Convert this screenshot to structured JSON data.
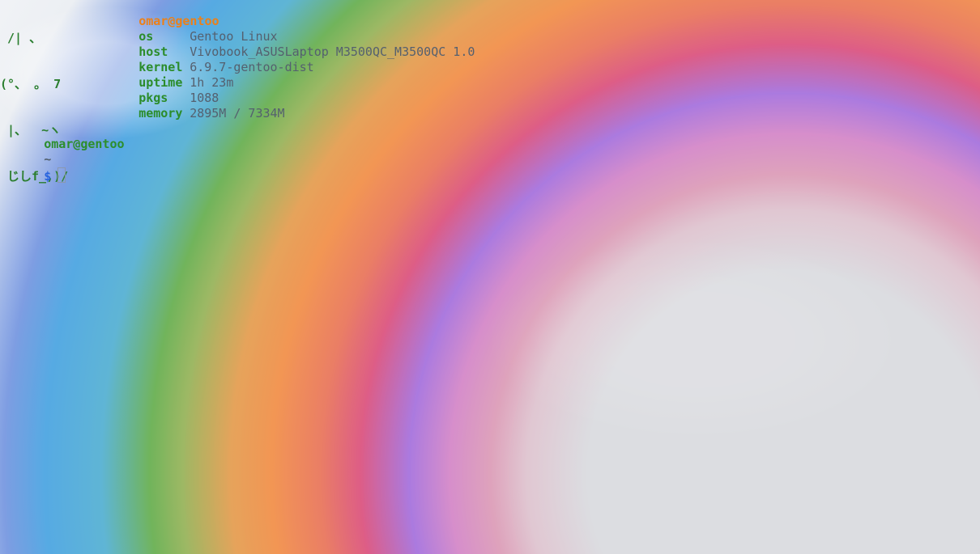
{
  "terminal": {
    "ascii_art": [
      " /| 、",
      "(°、 。 7",
      " |、  ~ヽ",
      " じしf_,)/"
    ],
    "info_title": "omar@gentoo",
    "info": [
      {
        "label": "os",
        "value": "Gentoo Linux"
      },
      {
        "label": "host",
        "value": "Vivobook_ASUSLaptop M3500QC_M3500QC 1.0"
      },
      {
        "label": "kernel",
        "value": "6.9.7-gentoo-dist"
      },
      {
        "label": "uptime",
        "value": "1h 23m"
      },
      {
        "label": "pkgs",
        "value": "1088"
      },
      {
        "label": "memory",
        "value": "2895M / 7334M"
      }
    ],
    "prompt": {
      "user_host": "omar@gentoo",
      "path": "~",
      "symbol": "$"
    }
  }
}
